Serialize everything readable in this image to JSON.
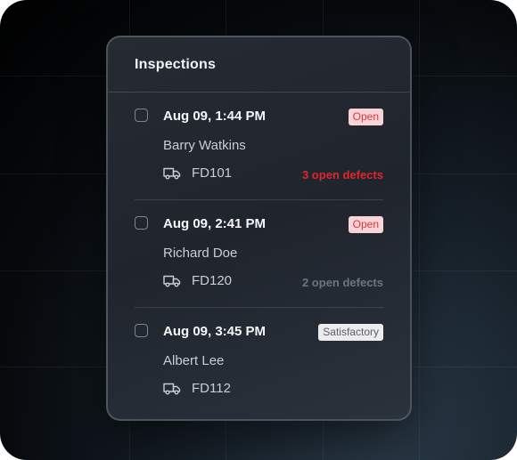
{
  "panel": {
    "title": "Inspections"
  },
  "colors": {
    "open_badge_bg": "#f8d4d6",
    "open_badge_text": "#d23a3f",
    "satisfactory_badge_bg": "#ececec",
    "defects_alert": "#e0262b",
    "defects_muted": "#6d7480"
  },
  "inspections": [
    {
      "date": "Aug 09, 1:44 PM",
      "status": "Open",
      "status_kind": "open",
      "inspector": "Barry Watkins",
      "vehicle_icon": "truck-icon",
      "vehicle": "FD101",
      "defects": "3 open defects",
      "defects_style": "alert"
    },
    {
      "date": "Aug 09, 2:41 PM",
      "status": "Open",
      "status_kind": "open",
      "inspector": "Richard Doe",
      "vehicle_icon": "truck-icon",
      "vehicle": "FD120",
      "defects": "2 open defects",
      "defects_style": "muted"
    },
    {
      "date": "Aug 09, 3:45 PM",
      "status": "Satisfactory",
      "status_kind": "satisfactory",
      "inspector": "Albert Lee",
      "vehicle_icon": "truck-icon",
      "vehicle": "FD112",
      "defects": "",
      "defects_style": "none"
    }
  ]
}
